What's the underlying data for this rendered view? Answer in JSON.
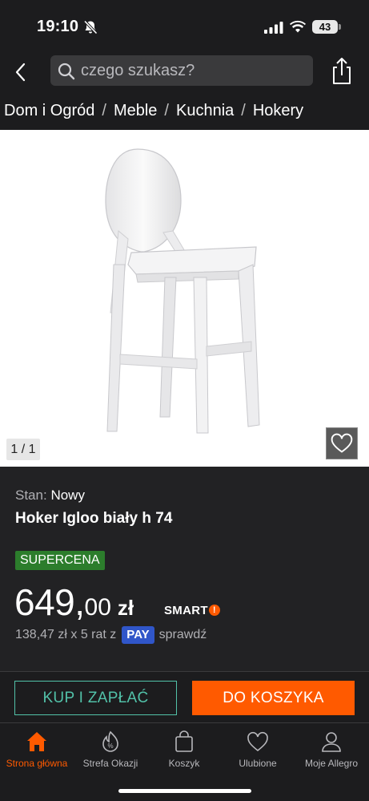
{
  "status_bar": {
    "time": "19:10",
    "battery": "43"
  },
  "header": {
    "search_placeholder": "czego szukasz?"
  },
  "breadcrumb": [
    "Dom i Ogród",
    "Meble",
    "Kuchnia",
    "Hokery"
  ],
  "gallery": {
    "counter": "1 / 1"
  },
  "product": {
    "condition_label": "Stan:",
    "condition_value": "Nowy",
    "title": "Hoker Igloo biały h 74",
    "badge": "SUPERCENA",
    "price_int": "649,",
    "price_dec": "00",
    "currency": "zł",
    "smart": "SMART",
    "installments_text": "138,47 zł x 5 rat z",
    "pay_label": "PAY",
    "check_label": "sprawdź"
  },
  "actions": {
    "buy_label": "KUP I ZAPŁAĆ",
    "cart_label": "DO KOSZYKA"
  },
  "bottom_nav": [
    {
      "label": "Strona główna",
      "icon": "home-icon",
      "active": true
    },
    {
      "label": "Strefa Okazji",
      "icon": "deals-icon",
      "active": false
    },
    {
      "label": "Koszyk",
      "icon": "cart-icon",
      "active": false
    },
    {
      "label": "Ulubione",
      "icon": "heart-icon",
      "active": false
    },
    {
      "label": "Moje Allegro",
      "icon": "user-icon",
      "active": false
    }
  ],
  "colors": {
    "accent": "#ff5a00",
    "teal": "#52c2a9",
    "badge_green": "#2c7d2c",
    "pay_blue": "#3056c9"
  }
}
